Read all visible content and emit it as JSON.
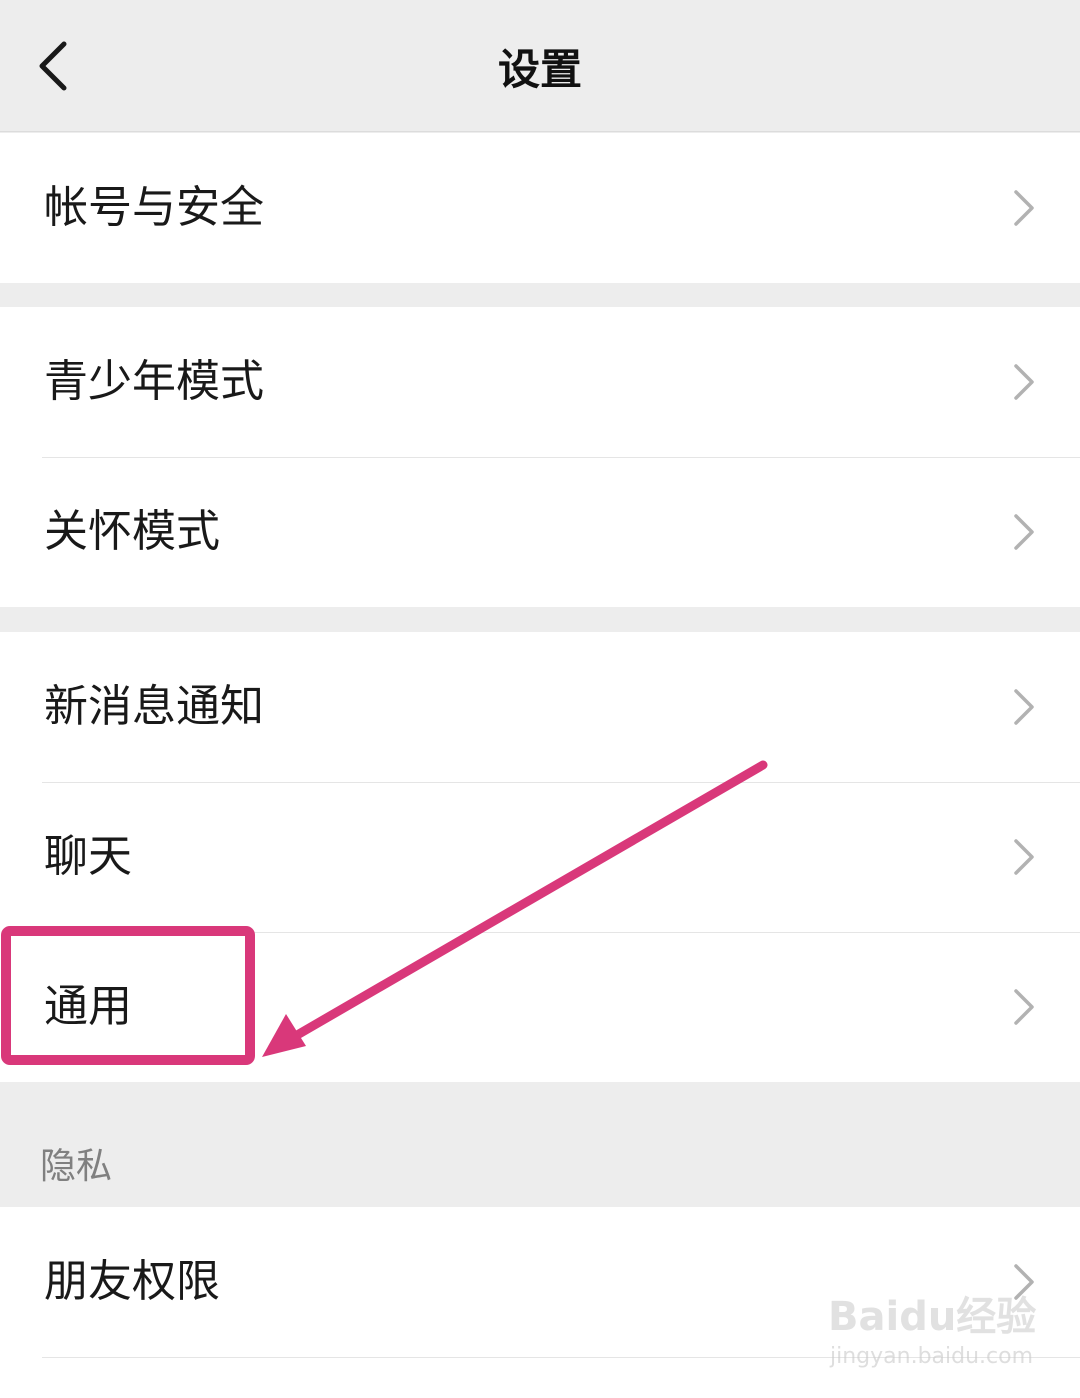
{
  "header": {
    "title": "设置",
    "back_icon": "chevron-left-icon"
  },
  "groups": {
    "account": [
      {
        "label": "帐号与安全"
      }
    ],
    "modes": [
      {
        "label": "青少年模式"
      },
      {
        "label": "关怀模式"
      }
    ],
    "general": [
      {
        "label": "新消息通知"
      },
      {
        "label": "聊天"
      },
      {
        "label": "通用"
      }
    ],
    "privacy": [
      {
        "label": "朋友权限"
      }
    ]
  },
  "sections": {
    "privacy_label": "隐私"
  },
  "annotation": {
    "color": "#d9387a",
    "highlighted_item": "通用"
  },
  "watermark": {
    "brand": "Baidu经验",
    "url": "jingyan.baidu.com"
  },
  "colors": {
    "background": "#ededed",
    "card": "#ffffff",
    "text": "#191919",
    "chevron": "#b2b2b2"
  }
}
